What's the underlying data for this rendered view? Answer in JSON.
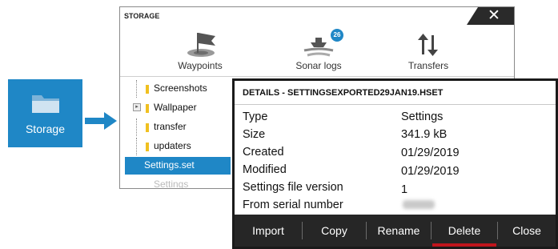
{
  "storage_tile": {
    "label": "Storage"
  },
  "storage_window": {
    "title": "STORAGE",
    "close_label": "✕",
    "categories": [
      {
        "label": "Waypoints"
      },
      {
        "label": "Sonar logs",
        "badge": "26"
      },
      {
        "label": "Transfers"
      }
    ],
    "files": [
      {
        "label": "Screenshots"
      },
      {
        "label": "Wallpaper"
      },
      {
        "label": "transfer"
      },
      {
        "label": "updaters"
      },
      {
        "label": "Settings.set"
      },
      {
        "label": "Settings database"
      }
    ]
  },
  "details": {
    "title": "DETAILS - SETTINGSEXPORTED29JAN19.HSET",
    "rows": [
      {
        "label": "Type",
        "value": "Settings"
      },
      {
        "label": "Size",
        "value": "341.9 kB"
      },
      {
        "label": "Created",
        "value": "01/29/2019"
      },
      {
        "label": "Modified",
        "value": "01/29/2019"
      },
      {
        "label": "Settings file version",
        "value": "1"
      },
      {
        "label": "From serial number",
        "value": ""
      }
    ],
    "buttons": [
      "Import",
      "Copy",
      "Rename",
      "Delete",
      "Close"
    ],
    "active_button": "Delete",
    "accent_color": "#c0151c"
  },
  "colors": {
    "brand_blue": "#1f87c6",
    "dark_bar": "#262626"
  }
}
